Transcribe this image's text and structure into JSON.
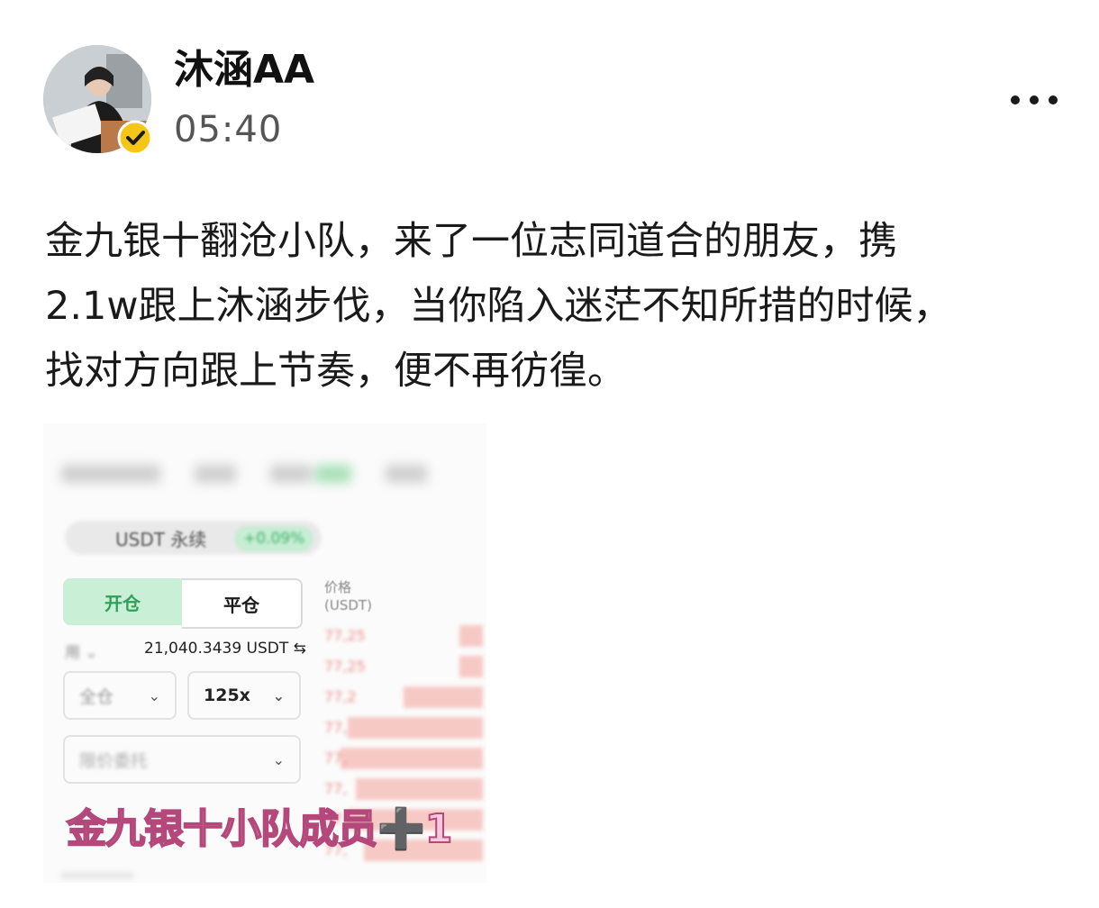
{
  "post": {
    "author": {
      "name": "沐涵AA",
      "avatar_icon": "avatar-photo",
      "badge_icon": "verified-badge-icon",
      "badge_color": "#f5c518"
    },
    "time": "05:40",
    "more_icon": "more-dots-icon",
    "text_lines": [
      "金九银十翻沧小队，来了一位志同道合的朋友，携",
      "2.1w跟上沐涵步伐，当你陷入迷茫不知所措的时候，",
      "找对方向跟上节奏，便不再彷徨。"
    ]
  },
  "media": {
    "pair_text": "USDT 永续",
    "pair_change": "+0.09%",
    "open_label": "开仓",
    "close_label": "平仓",
    "available_label": "用",
    "available_value": "21,040.3439 USDT",
    "margin_label": "全仓",
    "leverage_label": "125x",
    "order_type_label": "限价委托",
    "book_header": [
      "价格",
      "(USDT)"
    ],
    "book_prices": [
      "77,25",
      "77,25",
      "77,2",
      "77,",
      "77,",
      "77,",
      "77,",
      "77,"
    ],
    "book_depths": [
      0.15,
      0.15,
      0.5,
      0.85,
      0.9,
      0.8,
      0.85,
      0.75
    ],
    "caption": "金九银十小队成员➕1",
    "accent_green": "#2f9e5a",
    "sell_color": "#e98b84"
  }
}
